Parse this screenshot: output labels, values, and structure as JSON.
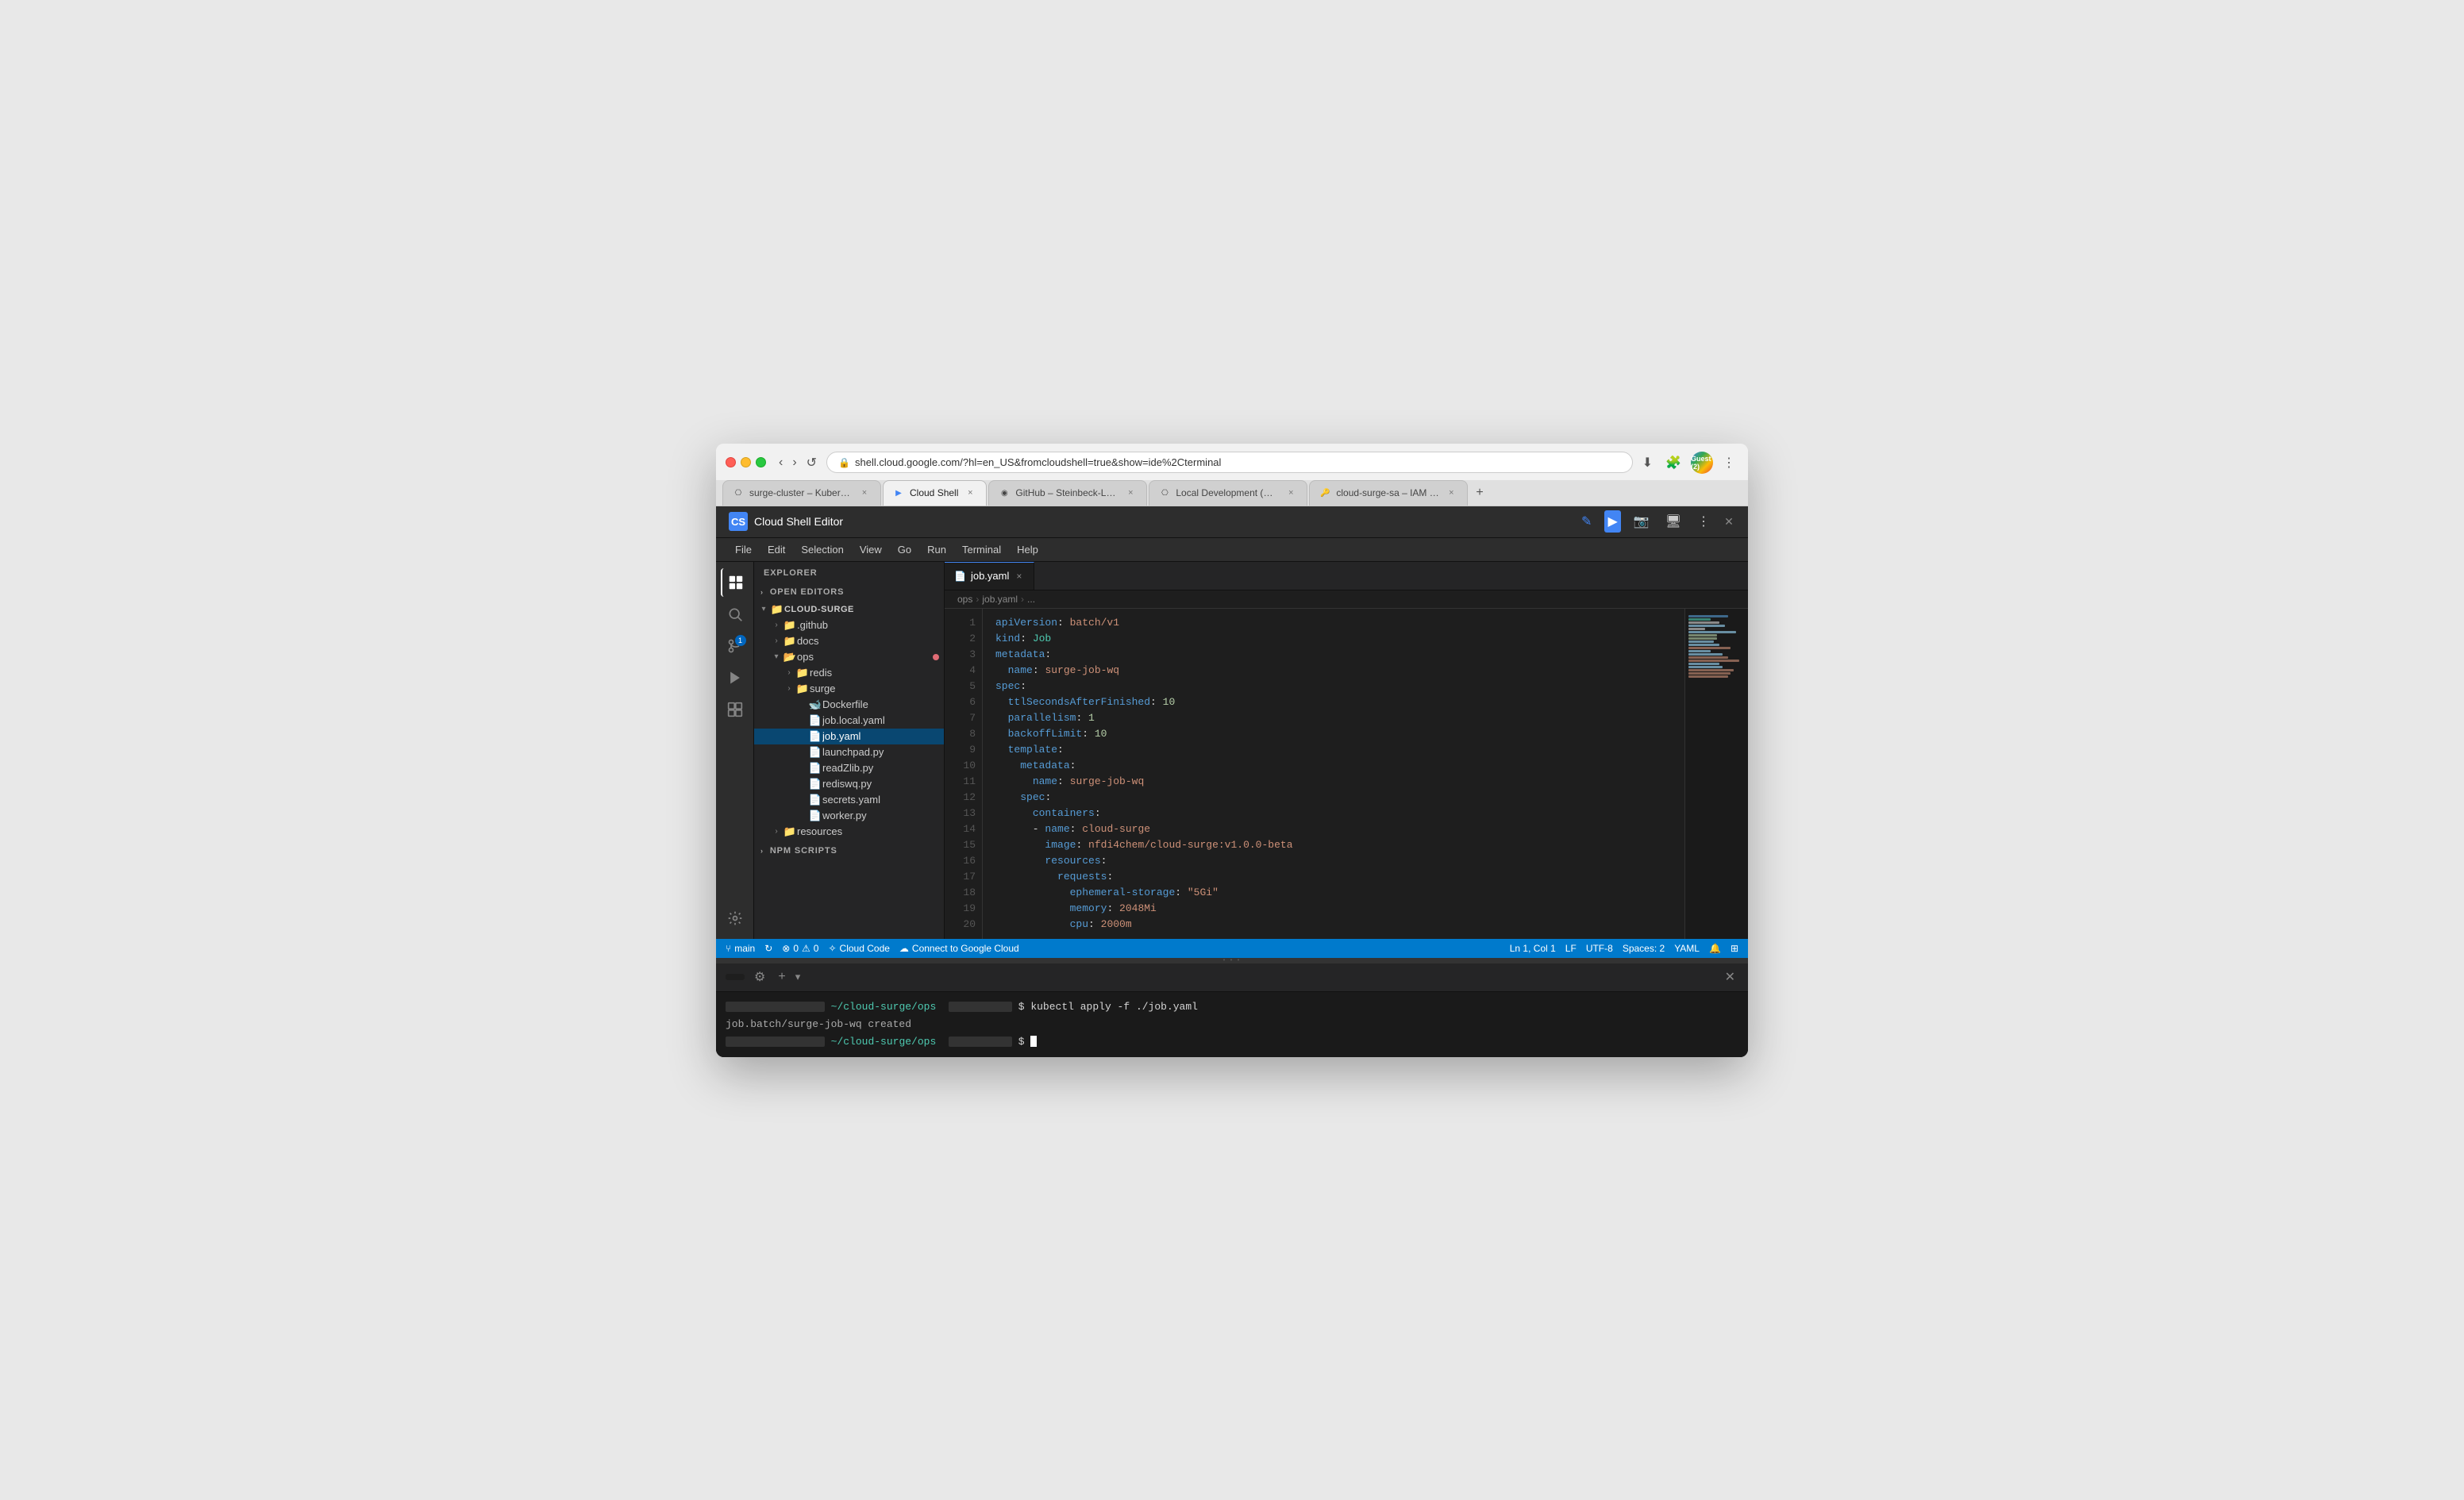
{
  "browser": {
    "url": "shell.cloud.google.com/?hl=en_US&fromcloudshell=true&show=ide%2Cterminal",
    "tabs": [
      {
        "id": "tab1",
        "title": "surge-cluster – Kubernetes En…",
        "favicon": "⎔",
        "active": false
      },
      {
        "id": "tab2",
        "title": "Cloud Shell",
        "favicon": "▶",
        "active": true
      },
      {
        "id": "tab3",
        "title": "GitHub – Steinbeck-Lab/cloud…",
        "favicon": "◉",
        "active": false
      },
      {
        "id": "tab4",
        "title": "Local Development (minikube…",
        "favicon": "⎔",
        "active": false
      },
      {
        "id": "tab5",
        "title": "cloud-surge-sa – IAM & Admi…",
        "favicon": "🔑",
        "active": false
      }
    ],
    "guest_label": "Guest (2)"
  },
  "app": {
    "title": "Cloud Shell Editor",
    "logo_text": "Cloud Shell Editor"
  },
  "menu": {
    "items": [
      "File",
      "Edit",
      "Selection",
      "View",
      "Go",
      "Run",
      "Terminal",
      "Help"
    ]
  },
  "activity_bar": {
    "items": [
      {
        "id": "explorer",
        "icon": "⧉",
        "active": true,
        "badge": null
      },
      {
        "id": "search",
        "icon": "🔍",
        "active": false
      },
      {
        "id": "source-control",
        "icon": "⑂",
        "active": false,
        "badge": "1"
      },
      {
        "id": "run-debug",
        "icon": "▷",
        "active": false
      },
      {
        "id": "extensions",
        "icon": "⊞",
        "active": false
      },
      {
        "id": "settings",
        "icon": "⚙",
        "active": false,
        "bottom": true
      }
    ]
  },
  "sidebar": {
    "title": "EXPLORER",
    "open_editors_label": "OPEN EDITORS",
    "root_label": "CLOUD-SURGE",
    "tree": [
      {
        "indent": 0,
        "type": "folder",
        "label": ".github",
        "open": false
      },
      {
        "indent": 0,
        "type": "folder",
        "label": "docs",
        "open": false
      },
      {
        "indent": 0,
        "type": "folder",
        "label": "ops",
        "open": true,
        "modified": true
      },
      {
        "indent": 1,
        "type": "folder",
        "label": "redis",
        "open": false
      },
      {
        "indent": 1,
        "type": "folder",
        "label": "surge",
        "open": false
      },
      {
        "indent": 1,
        "type": "file",
        "label": "Dockerfile",
        "icon": "🐋"
      },
      {
        "indent": 1,
        "type": "file",
        "label": "job.local.yaml",
        "icon": "📄"
      },
      {
        "indent": 1,
        "type": "file",
        "label": "job.yaml",
        "icon": "📄",
        "selected": true
      },
      {
        "indent": 1,
        "type": "file",
        "label": "launchpad.py",
        "icon": "🐍"
      },
      {
        "indent": 1,
        "type": "file",
        "label": "readZlib.py",
        "icon": "🐍"
      },
      {
        "indent": 1,
        "type": "file",
        "label": "rediswq.py",
        "icon": "🐍"
      },
      {
        "indent": 1,
        "type": "file",
        "label": "secrets.yaml",
        "icon": "📄"
      },
      {
        "indent": 1,
        "type": "file",
        "label": "worker.py",
        "icon": "🐍"
      },
      {
        "indent": 0,
        "type": "folder",
        "label": "resources",
        "open": false
      },
      {
        "indent": 0,
        "type": "section",
        "label": "NPM SCRIPTS"
      }
    ]
  },
  "editor": {
    "tab_label": "job.yaml",
    "breadcrumb": [
      "ops",
      ">",
      "job.yaml",
      ">",
      "..."
    ],
    "lines": [
      {
        "n": 1,
        "tokens": [
          {
            "t": "ck",
            "v": "apiVersion"
          },
          {
            "t": "co",
            "v": ": "
          },
          {
            "t": "cv",
            "v": "batch/v1"
          }
        ]
      },
      {
        "n": 2,
        "tokens": [
          {
            "t": "ck",
            "v": "kind"
          },
          {
            "t": "co",
            "v": ": "
          },
          {
            "t": "cm",
            "v": "Job"
          }
        ]
      },
      {
        "n": 3,
        "tokens": [
          {
            "t": "ck",
            "v": "metadata"
          },
          {
            "t": "co",
            "v": ":"
          }
        ]
      },
      {
        "n": 4,
        "tokens": [
          {
            "t": "",
            "v": "  "
          },
          {
            "t": "ck",
            "v": "name"
          },
          {
            "t": "co",
            "v": ": "
          },
          {
            "t": "cv",
            "v": "surge-job-wq"
          }
        ]
      },
      {
        "n": 5,
        "tokens": [
          {
            "t": "ck",
            "v": "spec"
          },
          {
            "t": "co",
            "v": ":"
          }
        ]
      },
      {
        "n": 6,
        "tokens": [
          {
            "t": "",
            "v": "  "
          },
          {
            "t": "ck",
            "v": "ttlSecondsAfterFinished"
          },
          {
            "t": "co",
            "v": ": "
          },
          {
            "t": "cn",
            "v": "10"
          }
        ]
      },
      {
        "n": 7,
        "tokens": [
          {
            "t": "",
            "v": "  "
          },
          {
            "t": "ck",
            "v": "parallelism"
          },
          {
            "t": "co",
            "v": ": "
          },
          {
            "t": "cn",
            "v": "1"
          }
        ]
      },
      {
        "n": 8,
        "tokens": [
          {
            "t": "",
            "v": "  "
          },
          {
            "t": "ck",
            "v": "backoffLimit"
          },
          {
            "t": "co",
            "v": ": "
          },
          {
            "t": "cn",
            "v": "10"
          }
        ]
      },
      {
        "n": 9,
        "tokens": [
          {
            "t": "",
            "v": "  "
          },
          {
            "t": "ck",
            "v": "template"
          },
          {
            "t": "co",
            "v": ":"
          }
        ]
      },
      {
        "n": 10,
        "tokens": [
          {
            "t": "",
            "v": "    "
          },
          {
            "t": "ck",
            "v": "metadata"
          },
          {
            "t": "co",
            "v": ":"
          }
        ]
      },
      {
        "n": 11,
        "tokens": [
          {
            "t": "",
            "v": "      "
          },
          {
            "t": "ck",
            "v": "name"
          },
          {
            "t": "co",
            "v": ": "
          },
          {
            "t": "cv",
            "v": "surge-job-wq"
          }
        ]
      },
      {
        "n": 12,
        "tokens": [
          {
            "t": "",
            "v": "    "
          },
          {
            "t": "ck",
            "v": "spec"
          },
          {
            "t": "co",
            "v": ":"
          }
        ]
      },
      {
        "n": 13,
        "tokens": [
          {
            "t": "",
            "v": "      "
          },
          {
            "t": "ck",
            "v": "containers"
          },
          {
            "t": "co",
            "v": ":"
          }
        ]
      },
      {
        "n": 14,
        "tokens": [
          {
            "t": "",
            "v": "      - "
          },
          {
            "t": "ck",
            "v": "name"
          },
          {
            "t": "co",
            "v": ": "
          },
          {
            "t": "cv",
            "v": "cloud-surge"
          }
        ]
      },
      {
        "n": 15,
        "tokens": [
          {
            "t": "",
            "v": "        "
          },
          {
            "t": "ck",
            "v": "image"
          },
          {
            "t": "co",
            "v": ": "
          },
          {
            "t": "cv",
            "v": "nfdi4chem/cloud-surge:v1.0.0-beta"
          }
        ]
      },
      {
        "n": 16,
        "tokens": [
          {
            "t": "",
            "v": "        "
          },
          {
            "t": "ck",
            "v": "resources"
          },
          {
            "t": "co",
            "v": ":"
          }
        ]
      },
      {
        "n": 17,
        "tokens": [
          {
            "t": "",
            "v": "          "
          },
          {
            "t": "ck",
            "v": "requests"
          },
          {
            "t": "co",
            "v": ":"
          }
        ]
      },
      {
        "n": 18,
        "tokens": [
          {
            "t": "",
            "v": "            "
          },
          {
            "t": "ck",
            "v": "ephemeral-storage"
          },
          {
            "t": "co",
            "v": ": "
          },
          {
            "t": "cv",
            "v": "\"5Gi\""
          }
        ]
      },
      {
        "n": 19,
        "tokens": [
          {
            "t": "",
            "v": "            "
          },
          {
            "t": "ck",
            "v": "memory"
          },
          {
            "t": "co",
            "v": ": "
          },
          {
            "t": "cv",
            "v": "2048Mi"
          }
        ]
      },
      {
        "n": 20,
        "tokens": [
          {
            "t": "",
            "v": "            "
          },
          {
            "t": "ck",
            "v": "cpu"
          },
          {
            "t": "co",
            "v": ": "
          },
          {
            "t": "cv",
            "v": "2000m"
          }
        ]
      }
    ]
  },
  "status_bar": {
    "branch": "main",
    "sync": "↻",
    "errors": "0",
    "warnings": "0",
    "cloud_code": "Cloud Code",
    "connect": "Connect to Google Cloud",
    "position": "Ln 1, Col 1",
    "line_ending": "LF",
    "encoding": "UTF-8",
    "spaces": "Spaces: 2",
    "language": "YAML"
  },
  "terminal": {
    "command1": "kubectl apply -f ./job.yaml",
    "output1": "job.batch/surge-job-wq created",
    "dir": "~/cloud-surge/ops"
  }
}
